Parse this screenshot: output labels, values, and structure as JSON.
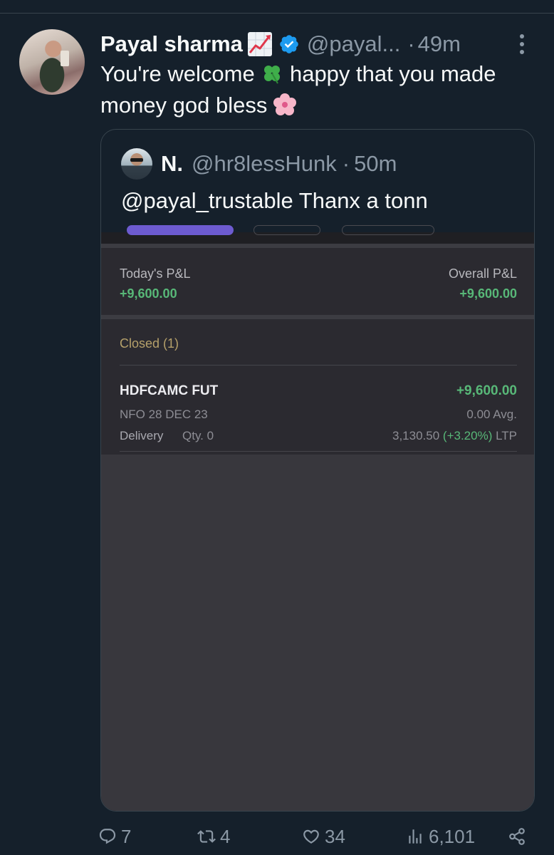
{
  "author": {
    "name": "Payal sharma",
    "handle": "@payal...",
    "separator": "·",
    "time": "49m"
  },
  "tweet": {
    "text_part1": "You're welcome ",
    "text_part2": " happy that you made money god bless "
  },
  "quoted": {
    "name": "N.",
    "handle": "@hr8lessHunk",
    "separator": "·",
    "time": "50m",
    "text": "@payal_trustable Thanx a tonn"
  },
  "screenshot": {
    "todays_pnl_label": "Today's P&L",
    "todays_pnl_value": "+9,600.00",
    "overall_pnl_label": "Overall P&L",
    "overall_pnl_value": "+9,600.00",
    "closed_label": "Closed (1)",
    "position": {
      "name": "HDFCAMC FUT",
      "pnl": "+9,600.00",
      "exchange": "NFO 28 DEC 23",
      "avg": "0.00 Avg.",
      "product": "Delivery",
      "qty": "Qty. 0",
      "ltp_price": "3,130.50 ",
      "ltp_change": "(+3.20%)",
      "ltp_suffix": " LTP"
    }
  },
  "actions": {
    "replies": "7",
    "retweets": "4",
    "likes": "34",
    "views": "6,101"
  },
  "colors": {
    "background": "#15202b",
    "muted": "#8b98a5",
    "verified": "#1d9bf0",
    "profit": "#58b878"
  }
}
